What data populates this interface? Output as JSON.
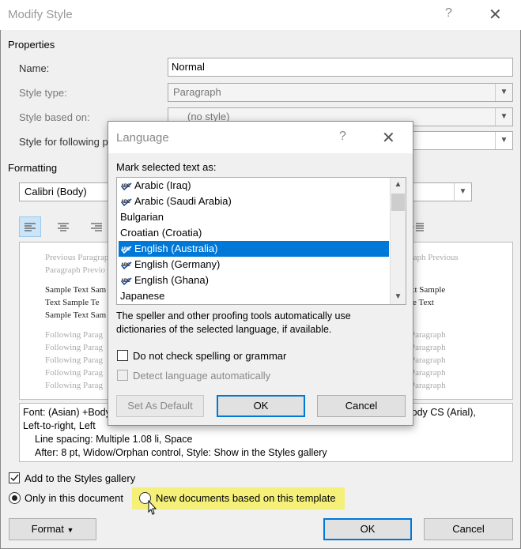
{
  "modify_style": {
    "title": "Modify Style",
    "help_glyph": "?",
    "close_glyph": "✕",
    "properties_label": "Properties",
    "name_label": "Name:",
    "name_value": "Normal",
    "style_type_label": "Style type:",
    "style_type_value": "Paragraph",
    "style_based_on_label": "Style based on:",
    "style_based_on_value": "(no style)",
    "style_following_label": "Style for following p",
    "formatting_label": "Formatting",
    "font_value": "Calibri (Body)",
    "preview": {
      "prev1": "Previous Paragrap",
      "prev2": "Paragraph Previo",
      "prev_r1": "raph Previous",
      "sample1": "Sample Text Sam",
      "sample2": "Text Sample Te",
      "sample3": "Sample Text Sam",
      "sample_r1": "xt Sample",
      "sample_r2": "le Text",
      "follow": "Following Parag",
      "follow_r": "Paragraph"
    },
    "description_line1": "Font: (Asian) +Body",
    "description_line1_right": "+Body CS (Arial),",
    "description_line2": "Left-to-right, Left",
    "description_line3": "Line spacing:  Multiple 1.08 li, Space",
    "description_line4": "After:  8 pt, Widow/Orphan control, Style: Show in the Styles gallery",
    "add_to_gallery_label": "Add to the Styles gallery",
    "only_this_doc_label": "Only in this document",
    "new_docs_label": "New documents based on this template",
    "format_button": "Format",
    "ok_button": "OK",
    "cancel_button": "Cancel"
  },
  "language": {
    "title": "Language",
    "help_glyph": "?",
    "close_glyph": "✕",
    "mark_label": "Mark selected text as:",
    "items": [
      {
        "label": "Arabic (Iraq)",
        "spell": true
      },
      {
        "label": "Arabic (Saudi Arabia)",
        "spell": true
      },
      {
        "label": "Bulgarian",
        "spell": false
      },
      {
        "label": "Croatian (Croatia)",
        "spell": false
      },
      {
        "label": "English (Australia)",
        "spell": true,
        "selected": true
      },
      {
        "label": "English (Germany)",
        "spell": true
      },
      {
        "label": "English (Ghana)",
        "spell": true
      },
      {
        "label": "Japanese",
        "spell": false
      }
    ],
    "info_line1": "The speller and other proofing tools automatically use",
    "info_line2": "dictionaries of the selected language, if available.",
    "no_check_label": "Do not check spelling or grammar",
    "detect_label": "Detect language automatically",
    "set_default_button": "Set As Default",
    "ok_button": "OK",
    "cancel_button": "Cancel"
  },
  "colors": {
    "accent": "#0078d7",
    "highlight": "#f4f07a"
  }
}
